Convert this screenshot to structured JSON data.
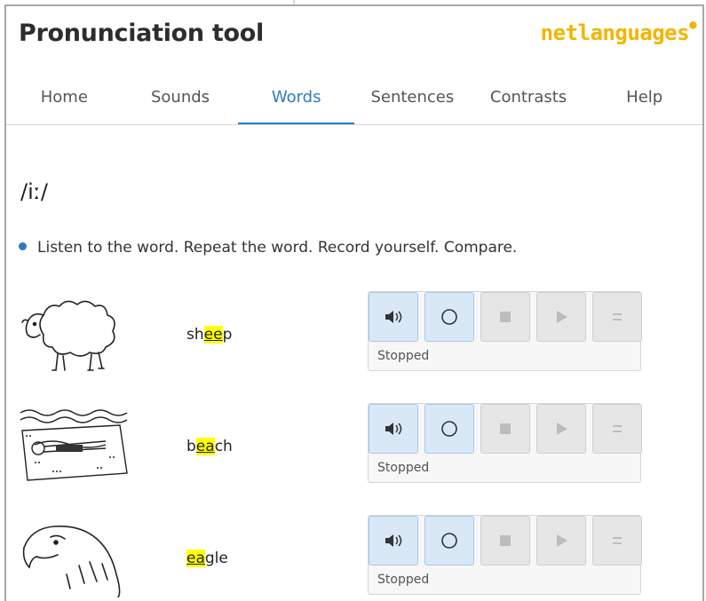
{
  "header": {
    "title": "Pronunciation tool",
    "brand": "netlanguages",
    "brand_mark": "●"
  },
  "nav": {
    "tabs": [
      {
        "label": "Home"
      },
      {
        "label": "Sounds"
      },
      {
        "label": "Words"
      },
      {
        "label": "Sentences"
      },
      {
        "label": "Contrasts"
      },
      {
        "label": "Help"
      }
    ],
    "active": "Words"
  },
  "phoneme": "/iː/",
  "instruction": "Listen to the word. Repeat the word. Record yourself. Compare.",
  "words": [
    {
      "pre": "sh",
      "hl": "ee",
      "post": "p",
      "status": "Stopped",
      "image": "sheep drawing"
    },
    {
      "pre": "b",
      "hl": "ea",
      "post": "ch",
      "status": "Stopped",
      "image": "beach drawing"
    },
    {
      "pre": "",
      "hl": "ea",
      "post": "gle",
      "status": "Stopped",
      "image": "eagle drawing"
    }
  ],
  "controls": {
    "listen": "speaker-icon",
    "record": "record-icon",
    "stop": "stop-icon",
    "play": "play-icon",
    "compare": "compare-icon"
  },
  "colors": {
    "accent": "#2f7bbf",
    "brand": "#f4b400",
    "highlight": "#ffff00"
  }
}
